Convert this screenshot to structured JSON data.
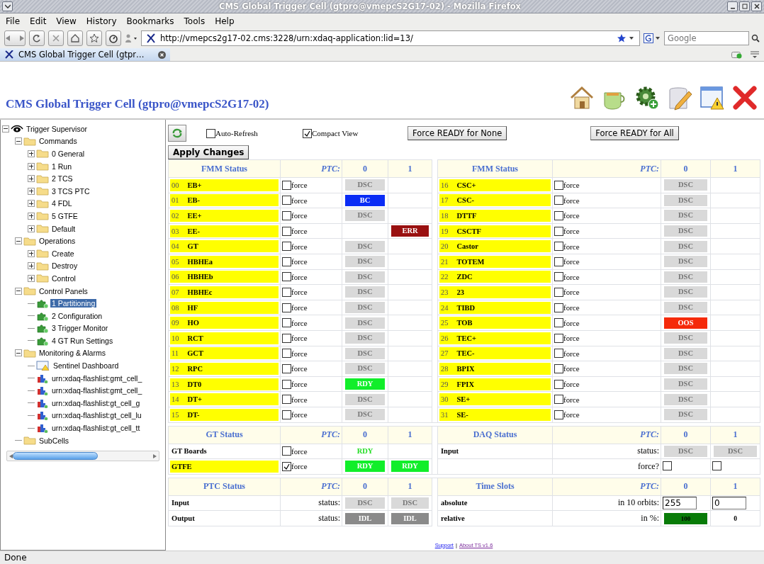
{
  "window": {
    "title": "CMS Global Trigger Cell (gtpro@vmepcS2G17-02) - Mozilla Firefox"
  },
  "menu": [
    "File",
    "Edit",
    "View",
    "History",
    "Bookmarks",
    "Tools",
    "Help"
  ],
  "navigation": {
    "url": "http://vmepcs2g17-02.cms:3228/urn:xdaq-application:lid=13/",
    "search": {
      "placeholder": "Google"
    }
  },
  "tabs": [
    {
      "title": "CMS Global Trigger Cell (gtpr…",
      "selected": true
    }
  ],
  "page": {
    "title": "CMS Global Trigger Cell (gtpro@vmepcS2G17-02)"
  },
  "tree": [
    {
      "label": "Trigger Supervisor",
      "kind": "supervisor",
      "expanded": true,
      "children": [
        {
          "label": "Commands",
          "kind": "folder",
          "expanded": true,
          "children": [
            {
              "label": "0 General",
              "kind": "folder",
              "expanded": false
            },
            {
              "label": "1 Run",
              "kind": "folder",
              "expanded": false
            },
            {
              "label": "2 TCS",
              "kind": "folder",
              "expanded": false
            },
            {
              "label": "3 TCS PTC",
              "kind": "folder",
              "expanded": false
            },
            {
              "label": "4 FDL",
              "kind": "folder",
              "expanded": false
            },
            {
              "label": "5 GTFE",
              "kind": "folder",
              "expanded": false
            },
            {
              "label": "Default",
              "kind": "folder",
              "expanded": false
            }
          ]
        },
        {
          "label": "Operations",
          "kind": "folder",
          "expanded": true,
          "children": [
            {
              "label": "Create",
              "kind": "folder",
              "expanded": false
            },
            {
              "label": "Destroy",
              "kind": "folder",
              "expanded": false
            },
            {
              "label": "Control",
              "kind": "folder",
              "expanded": false
            }
          ]
        },
        {
          "label": "Control Panels",
          "kind": "folder",
          "expanded": true,
          "children": [
            {
              "label": "1 Partitioning",
              "kind": "panel",
              "selected": true
            },
            {
              "label": "2 Configuration",
              "kind": "panel",
              "selected": false
            },
            {
              "label": "3 Trigger Monitor",
              "kind": "panel",
              "selected": false
            },
            {
              "label": "4 GT Run Settings",
              "kind": "panel",
              "selected": false
            }
          ]
        },
        {
          "label": "Monitoring & Alarms",
          "kind": "folder",
          "expanded": true,
          "children": [
            {
              "label": "Sentinel Dashboard",
              "kind": "dashboard",
              "selected": false
            },
            {
              "label": "urn:xdaq-flashlist:gmt_cell_",
              "kind": "chart",
              "selected": false
            },
            {
              "label": "urn:xdaq-flashlist:gmt_cell_",
              "kind": "chart",
              "selected": false
            },
            {
              "label": "urn:xdaq-flashlist:gt_cell_g",
              "kind": "chart",
              "selected": false
            },
            {
              "label": "urn:xdaq-flashlist:gt_cell_lu",
              "kind": "chart",
              "selected": false
            },
            {
              "label": "urn:xdaq-flashlist:gt_cell_tt",
              "kind": "chart",
              "selected": false
            }
          ]
        },
        {
          "label": "SubCells",
          "kind": "folder"
        }
      ]
    }
  ],
  "controls": {
    "auto_refresh": {
      "label": "Auto-Refresh",
      "checked": false
    },
    "compact_view": {
      "label": "Compact View",
      "checked": true
    },
    "buttons": [
      "Force READY for None",
      "Force READY for All"
    ],
    "apply": "Apply Changes"
  },
  "fmm_status": [
    {
      "title": "FMM Status",
      "ptc_label": "PTC:",
      "columns": [
        "0",
        "1"
      ],
      "rows": [
        {
          "index": "00",
          "name": "EB+",
          "force": {
            "label": "force",
            "checked": false
          },
          "ptc_0": {
            "kind": "dsc",
            "text": "DSC"
          }
        },
        {
          "index": "01",
          "name": "EB-",
          "force": {
            "label": "force",
            "checked": false
          },
          "ptc_0": {
            "kind": "bc",
            "text": "BC"
          }
        },
        {
          "index": "02",
          "name": "EE+",
          "force": {
            "label": "force",
            "checked": false
          },
          "ptc_0": {
            "kind": "dsc",
            "text": "DSC"
          }
        },
        {
          "index": "03",
          "name": "EE-",
          "force": {
            "label": "force",
            "checked": false
          },
          "ptc_1": {
            "kind": "err",
            "text": "ERR"
          }
        },
        {
          "index": "04",
          "name": "GT",
          "force": {
            "label": "force",
            "checked": false
          },
          "ptc_0": {
            "kind": "dsc",
            "text": "DSC"
          }
        },
        {
          "index": "05",
          "name": "HBHEa",
          "force": {
            "label": "force",
            "checked": false
          },
          "ptc_0": {
            "kind": "dsc",
            "text": "DSC"
          }
        },
        {
          "index": "06",
          "name": "HBHEb",
          "force": {
            "label": "force",
            "checked": false
          },
          "ptc_0": {
            "kind": "dsc",
            "text": "DSC"
          }
        },
        {
          "index": "07",
          "name": "HBHEc",
          "force": {
            "label": "force",
            "checked": false
          },
          "ptc_0": {
            "kind": "dsc",
            "text": "DSC"
          }
        },
        {
          "index": "08",
          "name": "HF",
          "force": {
            "label": "force",
            "checked": false
          },
          "ptc_0": {
            "kind": "dsc",
            "text": "DSC"
          }
        },
        {
          "index": "09",
          "name": "HO",
          "force": {
            "label": "force",
            "checked": false
          },
          "ptc_0": {
            "kind": "dsc",
            "text": "DSC"
          }
        },
        {
          "index": "10",
          "name": "RCT",
          "force": {
            "label": "force",
            "checked": false
          },
          "ptc_0": {
            "kind": "dsc",
            "text": "DSC"
          }
        },
        {
          "index": "11",
          "name": "GCT",
          "force": {
            "label": "force",
            "checked": false
          },
          "ptc_0": {
            "kind": "dsc",
            "text": "DSC"
          }
        },
        {
          "index": "12",
          "name": "RPC",
          "force": {
            "label": "force",
            "checked": false
          },
          "ptc_0": {
            "kind": "dsc",
            "text": "DSC"
          }
        },
        {
          "index": "13",
          "name": "DT0",
          "force": {
            "label": "force",
            "checked": false
          },
          "ptc_0": {
            "kind": "rdy",
            "text": "RDY"
          }
        },
        {
          "index": "14",
          "name": "DT+",
          "force": {
            "label": "force",
            "checked": false
          },
          "ptc_0": {
            "kind": "dsc",
            "text": "DSC"
          }
        },
        {
          "index": "15",
          "name": "DT-",
          "force": {
            "label": "force",
            "checked": false
          },
          "ptc_0": {
            "kind": "dsc",
            "text": "DSC"
          }
        }
      ]
    },
    {
      "title": "FMM Status",
      "ptc_label": "PTC:",
      "columns": [
        "0",
        "1"
      ],
      "rows": [
        {
          "index": "16",
          "name": "CSC+",
          "force": {
            "label": "force",
            "checked": false
          },
          "ptc_0": {
            "kind": "dsc",
            "text": "DSC"
          }
        },
        {
          "index": "17",
          "name": "CSC-",
          "force": {
            "label": "force",
            "checked": false
          },
          "ptc_0": {
            "kind": "dsc",
            "text": "DSC"
          }
        },
        {
          "index": "18",
          "name": "DTTF",
          "force": {
            "label": "force",
            "checked": false
          },
          "ptc_0": {
            "kind": "dsc",
            "text": "DSC"
          }
        },
        {
          "index": "19",
          "name": "CSCTF",
          "force": {
            "label": "force",
            "checked": false
          },
          "ptc_0": {
            "kind": "dsc",
            "text": "DSC"
          }
        },
        {
          "index": "20",
          "name": "Castor",
          "force": {
            "label": "force",
            "checked": false
          },
          "ptc_0": {
            "kind": "dsc",
            "text": "DSC"
          }
        },
        {
          "index": "21",
          "name": "TOTEM",
          "force": {
            "label": "force",
            "checked": false
          },
          "ptc_0": {
            "kind": "dsc",
            "text": "DSC"
          }
        },
        {
          "index": "22",
          "name": "ZDC",
          "force": {
            "label": "force",
            "checked": false
          },
          "ptc_0": {
            "kind": "dsc",
            "text": "DSC"
          }
        },
        {
          "index": "23",
          "name": "23",
          "force": {
            "label": "force",
            "checked": false
          },
          "ptc_0": {
            "kind": "dsc",
            "text": "DSC"
          }
        },
        {
          "index": "24",
          "name": "TIBD",
          "force": {
            "label": "force",
            "checked": false
          },
          "ptc_0": {
            "kind": "dsc",
            "text": "DSC"
          }
        },
        {
          "index": "25",
          "name": "TOB",
          "force": {
            "label": "force",
            "checked": false
          },
          "ptc_0": {
            "kind": "oos",
            "text": "OOS"
          }
        },
        {
          "index": "26",
          "name": "TEC+",
          "force": {
            "label": "force",
            "checked": false
          },
          "ptc_0": {
            "kind": "dsc",
            "text": "DSC"
          }
        },
        {
          "index": "27",
          "name": "TEC-",
          "force": {
            "label": "force",
            "checked": false
          },
          "ptc_0": {
            "kind": "dsc",
            "text": "DSC"
          }
        },
        {
          "index": "28",
          "name": "BPIX",
          "force": {
            "label": "force",
            "checked": false
          },
          "ptc_0": {
            "kind": "dsc",
            "text": "DSC"
          }
        },
        {
          "index": "29",
          "name": "FPIX",
          "force": {
            "label": "force",
            "checked": false
          },
          "ptc_0": {
            "kind": "dsc",
            "text": "DSC"
          }
        },
        {
          "index": "30",
          "name": "SE+",
          "force": {
            "label": "force",
            "checked": false
          },
          "ptc_0": {
            "kind": "dsc",
            "text": "DSC"
          }
        },
        {
          "index": "31",
          "name": "SE-",
          "force": {
            "label": "force",
            "checked": false
          },
          "ptc_0": {
            "kind": "dsc",
            "text": "DSC"
          }
        }
      ]
    }
  ],
  "gt_status": {
    "title": "GT Status",
    "ptc_label": "PTC:",
    "columns": [
      "0",
      "1"
    ],
    "rows": [
      {
        "name": "GT Boards",
        "highlighted": false,
        "force": {
          "label": "force",
          "checked": false
        },
        "ptc_0": {
          "kind": "rdy_text",
          "text": "RDY"
        }
      },
      {
        "name": "GTFE",
        "highlighted": true,
        "force": {
          "label": "force",
          "checked": true
        },
        "ptc_0": {
          "kind": "rdy",
          "text": "RDY"
        },
        "ptc_1": {
          "kind": "rdy",
          "text": "RDY"
        }
      }
    ]
  },
  "daq_status": {
    "title": "DAQ Status",
    "ptc_label": "PTC:",
    "columns": [
      "0",
      "1"
    ],
    "rows": [
      {
        "name": "Input",
        "label": "status:",
        "ptc_0": {
          "kind": "dsc",
          "text": "DSC"
        },
        "ptc_1": {
          "kind": "dsc",
          "text": "DSC"
        }
      },
      {
        "label": "force?",
        "ptc_0": {
          "kind": "checkbox",
          "checked": false
        },
        "ptc_1": {
          "kind": "checkbox",
          "checked": false
        }
      }
    ]
  },
  "ptc_status": {
    "title": "PTC Status",
    "ptc_label": "PTC:",
    "columns": [
      "0",
      "1"
    ],
    "rows": [
      {
        "name": "Input",
        "label": "status:",
        "ptc_0": {
          "kind": "dsc",
          "text": "DSC"
        },
        "ptc_1": {
          "kind": "dsc",
          "text": "DSC"
        }
      },
      {
        "name": "Output",
        "label": "status:",
        "ptc_0": {
          "kind": "idl",
          "text": "IDL"
        },
        "ptc_1": {
          "kind": "idl",
          "text": "IDL"
        }
      }
    ]
  },
  "time_slots": {
    "title": "Time Slots",
    "ptc_label": "PTC:",
    "columns": [
      "0",
      "1"
    ],
    "rows": [
      {
        "name": "absolute",
        "label": "in 10 orbits:",
        "ptc_0": {
          "kind": "input",
          "value": "255"
        },
        "ptc_1": {
          "kind": "input",
          "value": "0"
        }
      },
      {
        "name": "relative",
        "label": "in %:",
        "ptc_0": {
          "kind": "bar",
          "text": "100"
        },
        "ptc_1": {
          "kind": "plain",
          "text": "0"
        }
      }
    ]
  },
  "footer": {
    "links": [
      "Support",
      "About TS v1.6"
    ],
    "separator": "|"
  },
  "status_bar": {
    "text": "Done"
  }
}
